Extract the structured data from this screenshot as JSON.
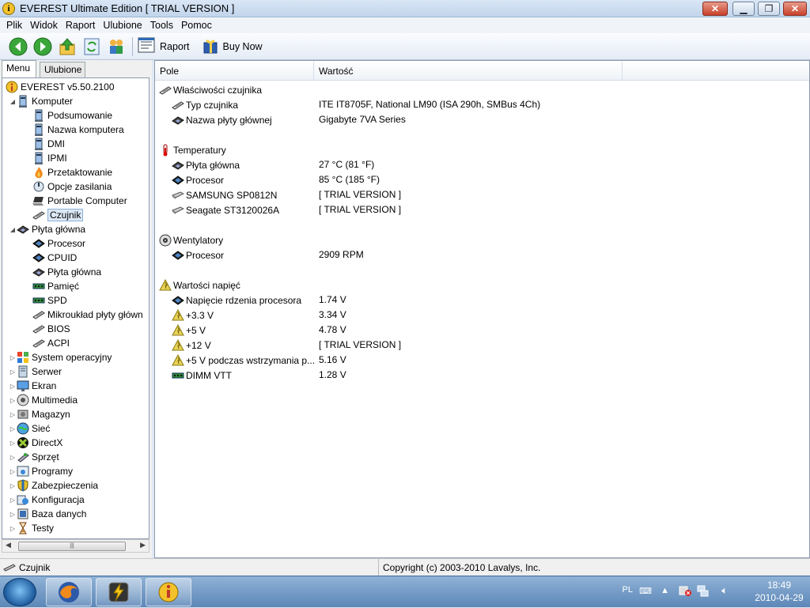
{
  "window": {
    "title": "EVEREST Ultimate Edition  [ TRIAL VERSION ]"
  },
  "menubar": [
    "Plik",
    "Widok",
    "Raport",
    "Ulubione",
    "Tools",
    "Pomoc"
  ],
  "toolbar": {
    "raport": "Raport",
    "buy_now": "Buy Now"
  },
  "tabs": {
    "menu": "Menu",
    "favorites": "Ulubione"
  },
  "tree": {
    "root": "EVEREST v5.50.2100",
    "komputer": "Komputer",
    "komputer_children": [
      "Podsumowanie",
      "Nazwa komputera",
      "DMI",
      "IPMI",
      "Przetaktowanie",
      "Opcje zasilania",
      "Portable Computer",
      "Czujnik"
    ],
    "plyta": "Płyta główna",
    "plyta_children": [
      "Procesor",
      "CPUID",
      "Płyta główna",
      "Pamięć",
      "SPD",
      "Mikroukład płyty główn",
      "BIOS",
      "ACPI"
    ],
    "others": [
      "System operacyjny",
      "Serwer",
      "Ekran",
      "Multimedia",
      "Magazyn",
      "Sieć",
      "DirectX",
      "Sprzęt",
      "Programy",
      "Zabezpieczenia",
      "Konfiguracja",
      "Baza danych",
      "Testy"
    ]
  },
  "columns": {
    "field": "Pole",
    "value": "Wartość"
  },
  "sections": [
    {
      "title": "Właściwości czujnika",
      "icon": "sensor-icon",
      "rows": [
        {
          "field": "Typ czujnika",
          "value": "ITE IT8705F, National LM90  (ISA 290h, SMBus 4Ch)",
          "icon": "sensor-icon"
        },
        {
          "field": "Nazwa płyty głównej",
          "value": "Gigabyte 7VA Series",
          "icon": "motherboard-icon"
        }
      ]
    },
    {
      "title": "Temperatury",
      "icon": "thermometer-icon",
      "rows": [
        {
          "field": "Płyta główna",
          "value": "27 °C  (81 °F)",
          "icon": "motherboard-icon"
        },
        {
          "field": "Procesor",
          "value": "85 °C  (185 °F)",
          "icon": "cpu-icon"
        },
        {
          "field": "SAMSUNG SP0812N",
          "value": "[ TRIAL VERSION ]",
          "icon": "hdd-icon"
        },
        {
          "field": "Seagate ST3120026A",
          "value": "[ TRIAL VERSION ]",
          "icon": "hdd-icon"
        }
      ]
    },
    {
      "title": "Wentylatory",
      "icon": "fan-icon",
      "rows": [
        {
          "field": "Procesor",
          "value": "2909 RPM",
          "icon": "cpu-icon"
        }
      ]
    },
    {
      "title": "Wartości napięć",
      "icon": "voltage-icon",
      "rows": [
        {
          "field": "Napięcie rdzenia procesora",
          "value": "1.74 V",
          "icon": "cpu-icon"
        },
        {
          "field": "+3.3 V",
          "value": "3.34 V",
          "icon": "voltage-icon"
        },
        {
          "field": "+5 V",
          "value": "4.78 V",
          "icon": "voltage-icon"
        },
        {
          "field": "+12 V",
          "value": "[ TRIAL VERSION ]",
          "icon": "voltage-icon"
        },
        {
          "field": "+5 V podczas wstrzymania p...",
          "value": "5.16 V",
          "icon": "voltage-icon"
        },
        {
          "field": "DIMM VTT",
          "value": "1.28 V",
          "icon": "memory-icon"
        }
      ]
    }
  ],
  "status": {
    "left": "Czujnik",
    "right": "Copyright (c) 2003-2010 Lavalys, Inc."
  },
  "taskbar": {
    "lang": "PL",
    "time": "18:49",
    "date": "2010-04-29"
  }
}
